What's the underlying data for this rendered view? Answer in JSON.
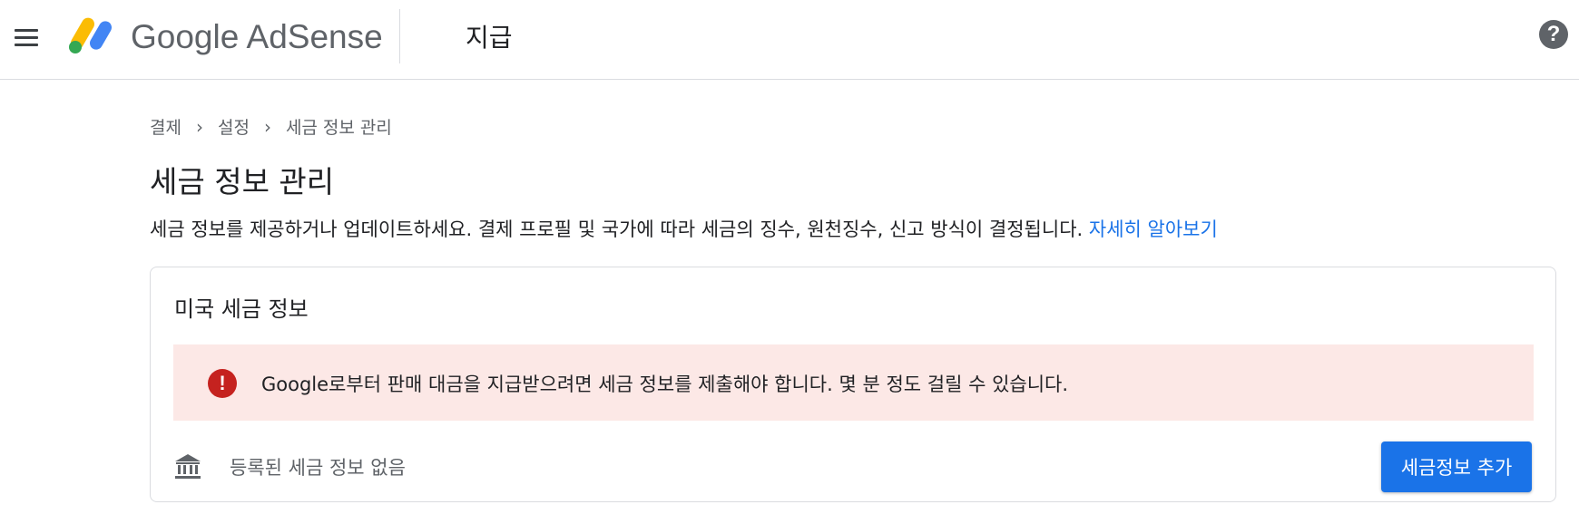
{
  "header": {
    "brand": "Google AdSense",
    "page_heading": "지급",
    "help_icon": "help-icon",
    "menu_icon": "hamburger-menu-icon",
    "logo_colors": {
      "yellow": "#fbbc04",
      "blue": "#4285f4",
      "green": "#34a853"
    }
  },
  "breadcrumb": {
    "items": [
      "결제",
      "설정",
      "세금 정보 관리"
    ],
    "separator": "›"
  },
  "page": {
    "title": "세금 정보 관리",
    "description": "세금 정보를 제공하거나 업데이트하세요. 결제 프로필 및 국가에 따라 세금의 징수, 원천징수, 신고 방식이 결정됩니다. ",
    "learn_more": "자세히 알아보기"
  },
  "card": {
    "title": "미국 세금 정보",
    "alert": {
      "icon": "error-icon",
      "icon_glyph": "!",
      "text": "Google로부터 판매 대금을 지급받으려면 세금 정보를 제출해야 합니다. 몇 분 정도 걸릴 수 있습니다.",
      "background": "#fce8e6",
      "icon_color": "#c5221f"
    },
    "status_icon": "bank-icon",
    "status_text": "등록된 세금 정보 없음",
    "add_button": "세금정보 추가"
  },
  "colors": {
    "accent": "#1a73e8",
    "text_primary": "#202124",
    "text_secondary": "#5f6368"
  }
}
